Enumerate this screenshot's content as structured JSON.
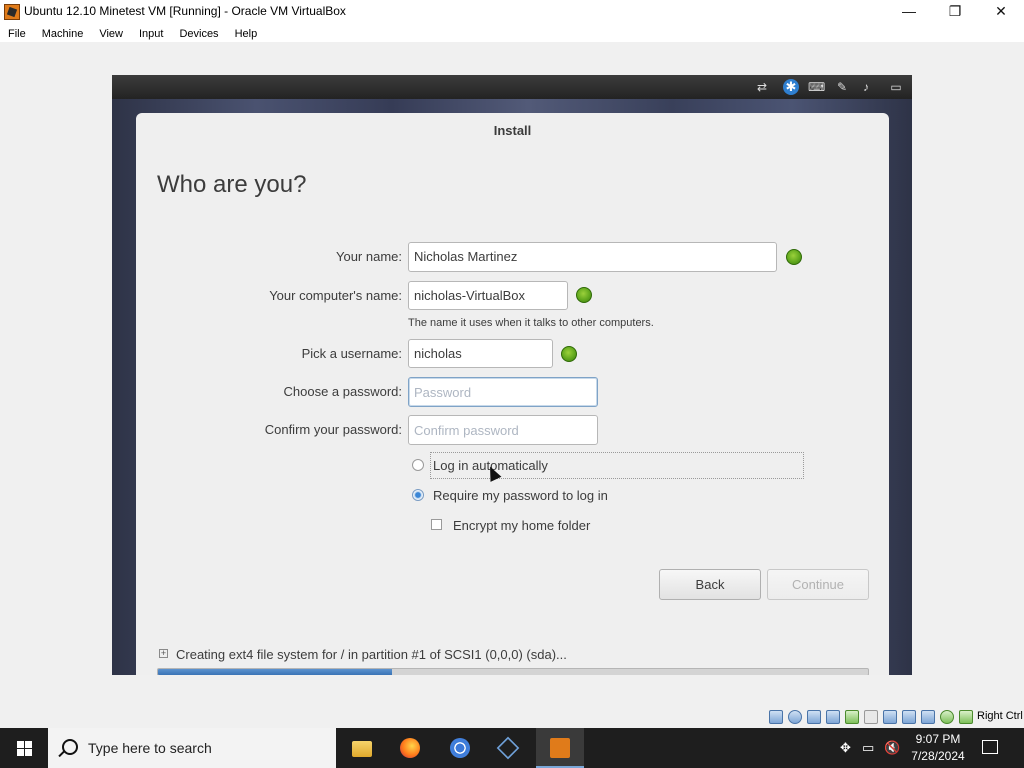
{
  "window": {
    "title": "Ubuntu 12.10 Minetest VM [Running] - Oracle VM VirtualBox",
    "minimize_glyph": "—",
    "maximize_glyph": "❐",
    "close_glyph": "✕"
  },
  "menu": [
    "File",
    "Machine",
    "View",
    "Input",
    "Devices",
    "Help"
  ],
  "installer": {
    "title": "Install",
    "heading": "Who are you?",
    "fields": {
      "name": {
        "label": "Your name:",
        "value": "Nicholas Martinez"
      },
      "computer": {
        "label": "Your computer's name:",
        "value": "nicholas-VirtualBox",
        "hint": "The name it uses when it talks to other computers."
      },
      "username": {
        "label": "Pick a username:",
        "value": "nicholas"
      },
      "password": {
        "label": "Choose a password:",
        "placeholder": "Password",
        "value": ""
      },
      "confirm": {
        "label": "Confirm your password:",
        "placeholder": "Confirm password",
        "value": ""
      }
    },
    "options": {
      "auto_login": {
        "label": "Log in automatically",
        "checked": false
      },
      "require_password": {
        "label": "Require my password to log in",
        "checked": true
      },
      "encrypt_home": {
        "label": "Encrypt my home folder",
        "checked": false
      }
    },
    "buttons": {
      "back": "Back",
      "continue": "Continue"
    },
    "status_text": "Creating ext4 file system for / in partition #1 of SCSI1 (0,0,0) (sda)...",
    "progress_fraction": 0.33
  },
  "vm_tray_icons": [
    "network-icon",
    "accessibility-icon",
    "keyboard-icon",
    "input-method-icon",
    "volume-icon",
    "display-icon"
  ],
  "vbox_status": {
    "icons": [
      "hard-disk-icon",
      "optical-drive-icon",
      "audio-icon",
      "network-adapter-icon",
      "usb-icon",
      "shared-folders-icon",
      "display-icon",
      "video-capture-icon",
      "virtualization-icon",
      "mouse-integration-icon",
      "cpu-icon"
    ],
    "host_key": "Right Ctrl"
  },
  "taskbar": {
    "search_placeholder": "Type here to search",
    "apps": [
      "file-explorer",
      "firefox",
      "chrome",
      "virtualbox",
      "virtualbox-vm"
    ],
    "time": "9:07 PM",
    "date": "7/28/2024"
  },
  "colors": {
    "accent": "#3b86d6",
    "ok_green": "#62a81e",
    "dialog_bg": "#efefef",
    "taskbar_bg": "#1e1e1e"
  }
}
